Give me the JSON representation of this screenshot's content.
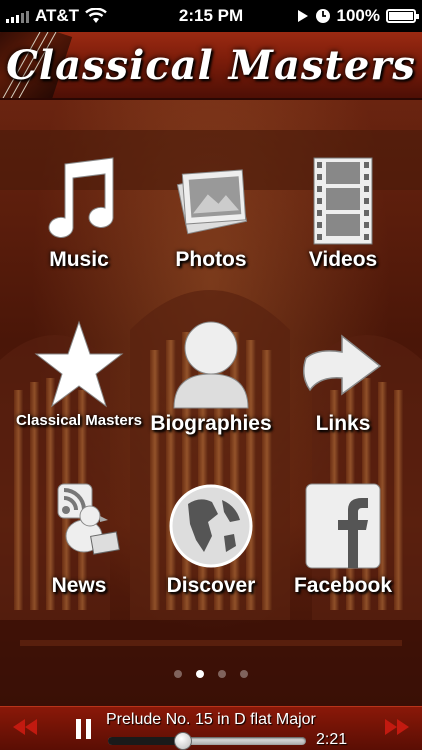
{
  "status_bar": {
    "carrier": "AT&T",
    "time": "2:15 PM",
    "battery": "100%"
  },
  "header": {
    "title": "Classical Masters"
  },
  "tiles": [
    {
      "label": "Music",
      "icon": "music-note-icon"
    },
    {
      "label": "Photos",
      "icon": "photos-icon"
    },
    {
      "label": "Videos",
      "icon": "film-strip-icon"
    },
    {
      "label": "Classical Masters",
      "icon": "star-icon"
    },
    {
      "label": "Biographies",
      "icon": "person-icon"
    },
    {
      "label": "Links",
      "icon": "arrow-icon"
    },
    {
      "label": "News",
      "icon": "rss-bird-icon"
    },
    {
      "label": "Discover",
      "icon": "globe-icon"
    },
    {
      "label": "Facebook",
      "icon": "facebook-icon"
    }
  ],
  "pager": {
    "pages": 4,
    "current": 2
  },
  "player": {
    "track_title": "Prelude No. 15 in D flat Major",
    "time": "2:21",
    "progress": 0.38
  },
  "colors": {
    "header": "#7a1c0a",
    "player": "#8a1808",
    "player_buttons": "#c21a10"
  }
}
